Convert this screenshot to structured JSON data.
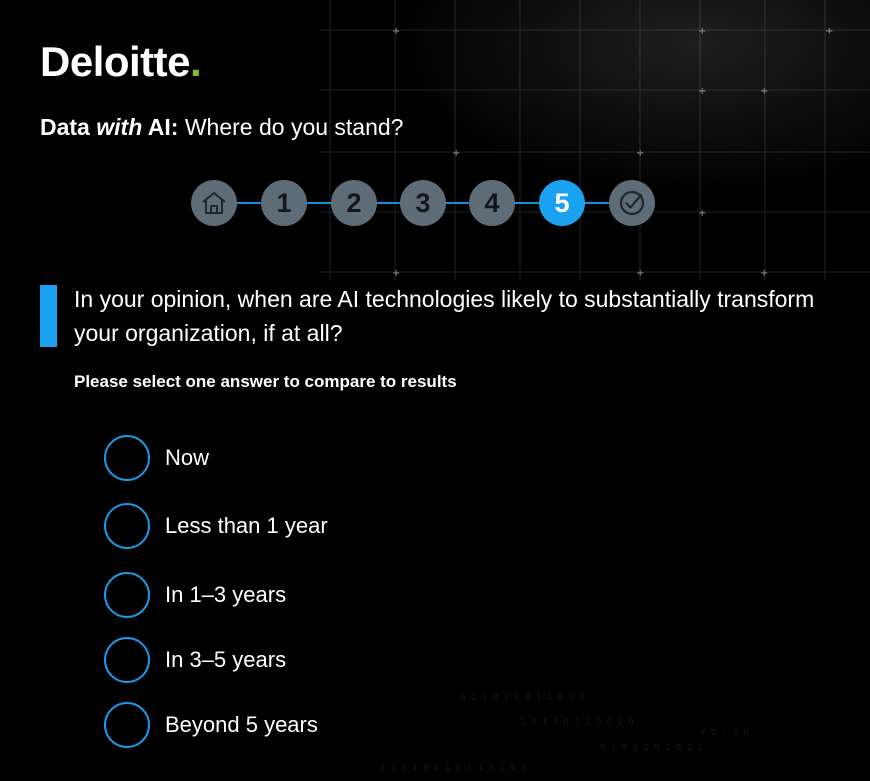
{
  "brand": {
    "name": "Deloitte",
    "dot": ".",
    "dot_color": "#86bc25"
  },
  "survey": {
    "title_part1": "Data ",
    "title_part2": "with",
    "title_part3": " AI:",
    "title_part4": " Where do you stand?"
  },
  "stepper": {
    "home_icon": "home-icon",
    "steps": [
      "1",
      "2",
      "3",
      "4",
      "5"
    ],
    "active_step": "5",
    "complete_icon": "check-circle-icon",
    "line_color": "#1a8fd8",
    "active_color": "#1aa1ef",
    "inactive_color": "#5e6c78"
  },
  "question": {
    "text": "In your opinion, when are AI technologies likely to substantially transform your organization, if at all?",
    "instruction": "Please select one answer to compare to results"
  },
  "options": [
    {
      "label": "Now"
    },
    {
      "label": "Less than 1 year"
    },
    {
      "label": "In 1–3 years"
    },
    {
      "label": "In 3–5 years"
    },
    {
      "label": "Beyond 5 years"
    }
  ]
}
